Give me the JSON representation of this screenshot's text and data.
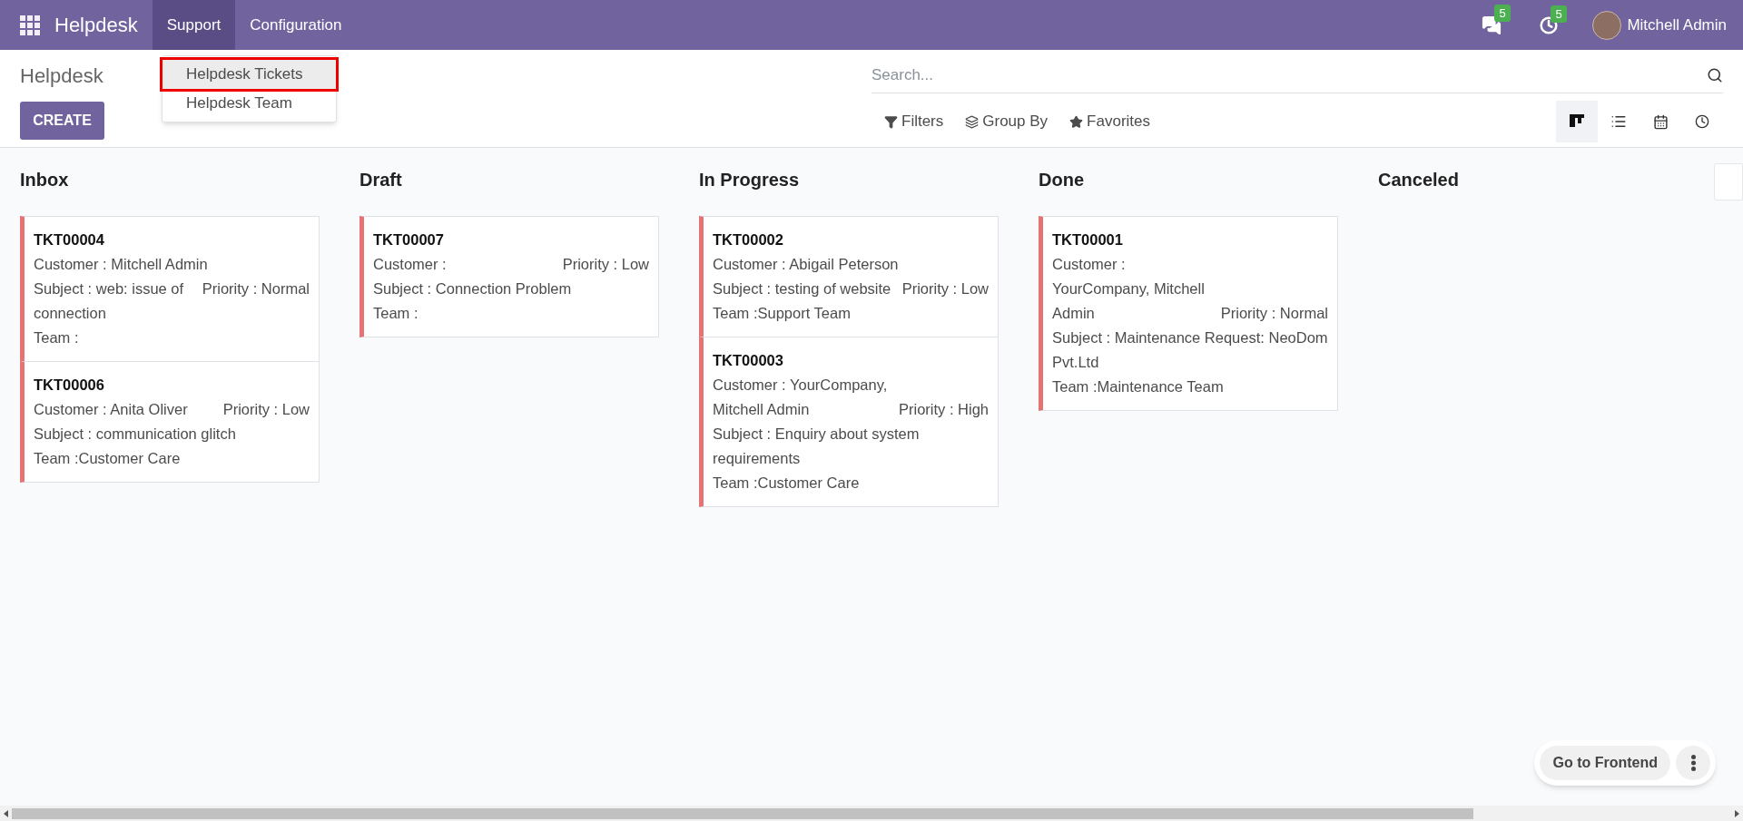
{
  "navbar": {
    "app_name": "Helpdesk",
    "menus": [
      {
        "label": "Support",
        "selected": true
      },
      {
        "label": "Configuration",
        "selected": false
      }
    ],
    "messages_badge": "5",
    "activities_badge": "5",
    "user": "Mitchell Admin"
  },
  "dropdown": {
    "items": [
      {
        "label": "Helpdesk Tickets",
        "highlighted": true
      },
      {
        "label": "Helpdesk Team",
        "highlighted": false
      }
    ]
  },
  "control_panel": {
    "title": "Helpdesk",
    "create_button": "CREATE",
    "search": {
      "placeholder": "Search..."
    },
    "filters": [
      {
        "kind": "filter",
        "label": "Filters"
      },
      {
        "kind": "groupby",
        "label": "Group By"
      },
      {
        "kind": "favorites",
        "label": "Favorites"
      }
    ],
    "views": [
      {
        "kind": "kanban",
        "selected": true
      },
      {
        "kind": "list",
        "selected": false
      },
      {
        "kind": "calendar",
        "selected": false
      },
      {
        "kind": "activity",
        "selected": false
      }
    ]
  },
  "columns": [
    {
      "title": "Inbox",
      "cards": [
        {
          "ref": "TKT00004",
          "customer": "Customer : Mitchell Admin",
          "priority": "Priority : Normal",
          "kind": "stacked",
          "subject": "Subject : web: issue of connection",
          "team": "Team :"
        },
        {
          "ref": "TKT00006",
          "customer": "Customer : Anita Oliver",
          "priority": "Priority : Low",
          "kind": "inline",
          "subject": "Subject : communication glitch",
          "team": "Team :Customer Care"
        }
      ]
    },
    {
      "title": "Draft",
      "cards": [
        {
          "ref": "TKT00007",
          "customer": "Customer :",
          "priority": "Priority : Low",
          "kind": "inline",
          "subject": "Subject : Connection Problem",
          "team": "Team :"
        }
      ]
    },
    {
      "title": "In Progress",
      "cards": [
        {
          "ref": "TKT00002",
          "customer": "Customer : Abigail Peterson",
          "priority": "Priority : Low",
          "kind": "stacked",
          "subject": "Subject : testing of website",
          "team": "Team :Support Team"
        },
        {
          "ref": "TKT00003",
          "customer": "Customer : YourCompany, Mitchell Admin",
          "priority": "Priority : High",
          "kind": "inline",
          "subject": "Subject : Enquiry about system requirements",
          "team": "Team :Customer Care"
        }
      ]
    },
    {
      "title": "Done",
      "cards": [
        {
          "ref": "TKT00001",
          "customer": "Customer : YourCompany, Mitchell Admin",
          "priority": "Priority : Normal",
          "kind": "inline",
          "subject": "Subject : Maintenance Request: NeoDom Pvt.Ltd",
          "team": "Team :Maintenance Team"
        }
      ]
    },
    {
      "title": "Canceled"
    }
  ],
  "frontend_button": "Go to Frontend"
}
